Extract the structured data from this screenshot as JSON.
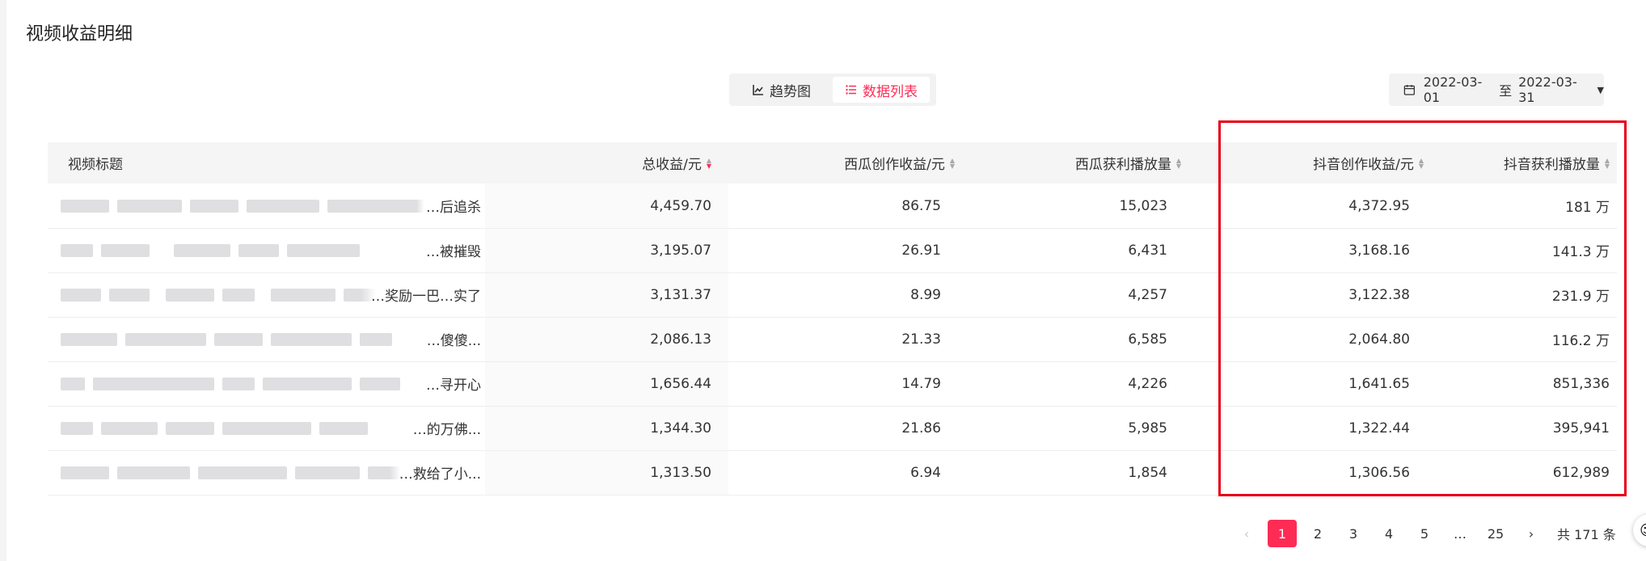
{
  "page": {
    "title": "视频收益明细"
  },
  "view_toggle": {
    "trend_label": "趋势图",
    "list_label": "数据列表",
    "active": "list"
  },
  "date_range": {
    "start": "2022-03-01",
    "separator": "至",
    "end": "2022-03-31",
    "icon": "calendar-icon"
  },
  "table": {
    "columns": [
      "视频标题",
      "总收益/元",
      "西瓜创作收益/元",
      "西瓜获利播放量",
      "抖音创作收益/元",
      "抖音获利播放量"
    ],
    "rows": [
      {
        "title_visible": "…后追杀",
        "total": "4,459.70",
        "xigua_income": "86.75",
        "xigua_plays": "15,023",
        "douyin_income": "4,372.95",
        "douyin_plays": "181 万"
      },
      {
        "title_visible": "…被摧毁",
        "total": "3,195.07",
        "xigua_income": "26.91",
        "xigua_plays": "6,431",
        "douyin_income": "3,168.16",
        "douyin_plays": "141.3 万"
      },
      {
        "title_visible": "…奖励一巴…实了",
        "total": "3,131.37",
        "xigua_income": "8.99",
        "xigua_plays": "4,257",
        "douyin_income": "3,122.38",
        "douyin_plays": "231.9 万"
      },
      {
        "title_visible": "…傻傻...",
        "total": "2,086.13",
        "xigua_income": "21.33",
        "xigua_plays": "6,585",
        "douyin_income": "2,064.80",
        "douyin_plays": "116.2 万"
      },
      {
        "title_visible": "…寻开心",
        "total": "1,656.44",
        "xigua_income": "14.79",
        "xigua_plays": "4,226",
        "douyin_income": "1,641.65",
        "douyin_plays": "851,336"
      },
      {
        "title_visible": "…的万佛...",
        "total": "1,344.30",
        "xigua_income": "21.86",
        "xigua_plays": "5,985",
        "douyin_income": "1,322.44",
        "douyin_plays": "395,941"
      },
      {
        "title_visible": "…救给了小...",
        "total": "1,313.50",
        "xigua_income": "6.94",
        "xigua_plays": "1,854",
        "douyin_income": "1,306.56",
        "douyin_plays": "612,989"
      }
    ]
  },
  "pagination": {
    "pages": [
      "1",
      "2",
      "3",
      "4",
      "5",
      "…",
      "25"
    ],
    "current": "1",
    "total_text": "共 171 条"
  },
  "colors": {
    "accent": "#fe2c55",
    "highlight": "#e60012"
  }
}
